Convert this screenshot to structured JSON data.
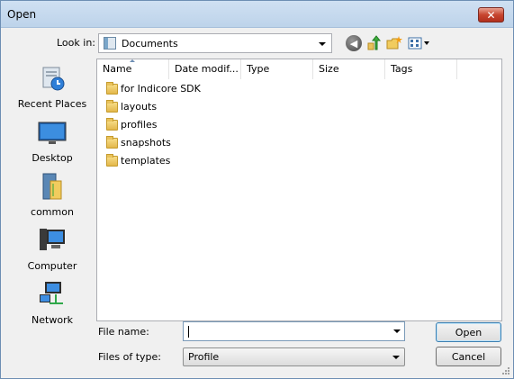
{
  "window": {
    "title": "Open"
  },
  "lookin": {
    "label": "Look in:",
    "value": "Documents"
  },
  "places": [
    {
      "label": "Recent Places",
      "icon": "recent-places-icon"
    },
    {
      "label": "Desktop",
      "icon": "desktop-icon"
    },
    {
      "label": "common",
      "icon": "common-folder-icon"
    },
    {
      "label": "Computer",
      "icon": "computer-icon"
    },
    {
      "label": "Network",
      "icon": "network-icon"
    }
  ],
  "columns": [
    "Name",
    "Date modif...",
    "Type",
    "Size",
    "Tags"
  ],
  "files": [
    {
      "name": "for Indicore SDK",
      "icon": "folder-icon"
    },
    {
      "name": "layouts",
      "icon": "folder-icon"
    },
    {
      "name": "profiles",
      "icon": "folder-icon"
    },
    {
      "name": "snapshots",
      "icon": "folder-icon"
    },
    {
      "name": "templates",
      "icon": "folder-icon"
    }
  ],
  "filename": {
    "label": "File name:",
    "value": ""
  },
  "filetype": {
    "label": "Files of type:",
    "value": "Profile"
  },
  "buttons": {
    "open": "Open",
    "cancel": "Cancel",
    "close": "✕"
  },
  "colors": {
    "title_bar": "#bdd3ea",
    "close_button": "#c7452f",
    "folder": "#e9c25a"
  }
}
